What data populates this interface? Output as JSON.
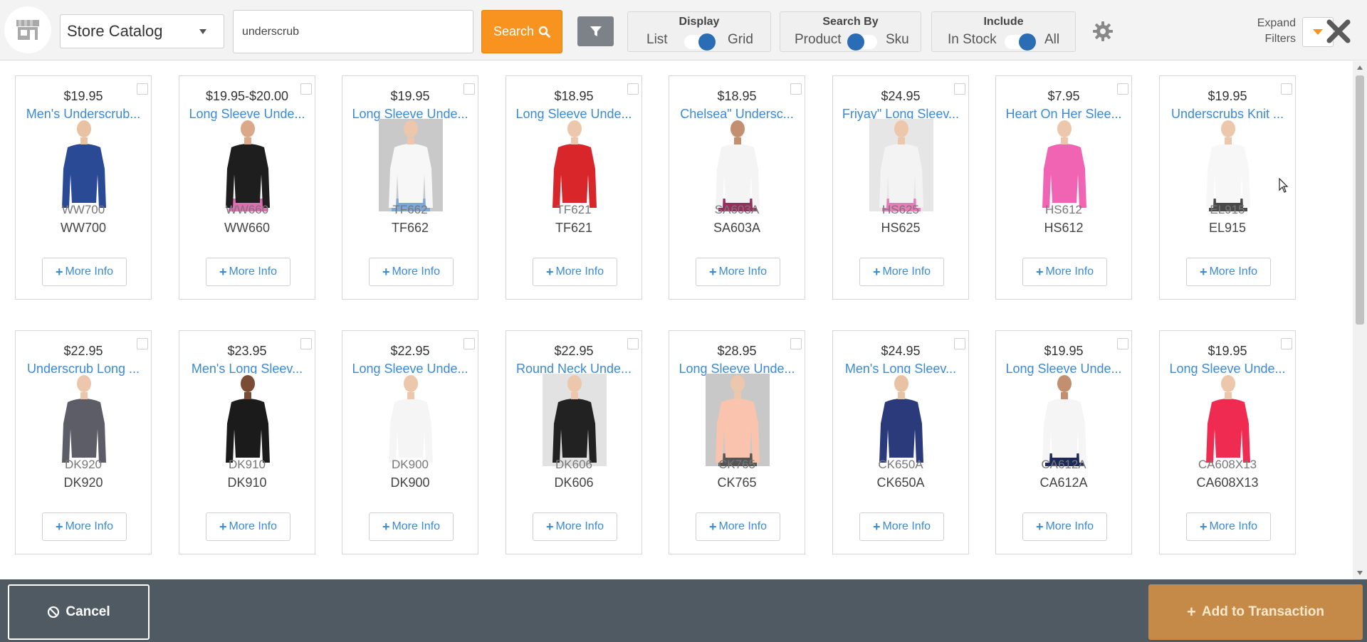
{
  "header": {
    "catalog_select": "Store Catalog",
    "search_value": "underscrub",
    "search_button": "Search",
    "display": {
      "title": "Display",
      "left": "List",
      "right": "Grid",
      "selected": "Grid"
    },
    "search_by": {
      "title": "Search By",
      "left": "Product",
      "right": "Sku",
      "selected": "Product"
    },
    "include": {
      "title": "Include",
      "left": "In Stock",
      "right": "All",
      "selected": "All"
    },
    "expand_filters_line1": "Expand",
    "expand_filters_line2": "Filters"
  },
  "colors": {
    "accent": "#f7931e",
    "link": "#3a8ad6",
    "toggle": "#2a6db5",
    "bottom_bar": "#505a63",
    "add_button": "#c58a48"
  },
  "products": [
    {
      "price": "$19.95",
      "name": "Men's Underscrub...",
      "sku": "WW700",
      "shirt": "#2b4a95",
      "pants": "",
      "bg": "#ffffff",
      "skin": "#e9c2a4"
    },
    {
      "price": "$19.95-$20.00",
      "name": "Long Sleeve Unde...",
      "sku": "WW660",
      "shirt": "#1e1e1e",
      "pants": "#e36bb2",
      "bg": "#ffffff",
      "skin": "#d9a98a"
    },
    {
      "price": "$19.95",
      "name": "Long Sleeve Unde...",
      "sku": "TF662",
      "shirt": "#f7f7f7",
      "pants": "#7ea8d8",
      "bg": "#c9c9c9",
      "skin": "#ecc7ab"
    },
    {
      "price": "$18.95",
      "name": "Long Sleeve Unde...",
      "sku": "TF621",
      "shirt": "#d8262b",
      "pants": "",
      "bg": "#ffffff",
      "skin": "#ecc7ab"
    },
    {
      "price": "$18.95",
      "name": "Chelsea\" Undersc...",
      "sku": "SA603A",
      "shirt": "#f4f4f4",
      "pants": "#9b2c5e",
      "bg": "#ffffff",
      "skin": "#c28f70"
    },
    {
      "price": "$24.95",
      "name": "Friyay\" Long Sleev...",
      "sku": "HS625",
      "shirt": "#f3f3f3",
      "pants": "#e97cb9",
      "bg": "#e6e6e6",
      "skin": "#ecc7ab"
    },
    {
      "price": "$7.95",
      "name": "Heart On Her Slee...",
      "sku": "HS612",
      "shirt": "#f064b3",
      "pants": "",
      "bg": "#ffffff",
      "skin": "#ecc7ab"
    },
    {
      "price": "$19.95",
      "name": "Underscrubs Knit ...",
      "sku": "EL915",
      "shirt": "#f7f7f7",
      "pants": "#4a4a4a",
      "bg": "#ffffff",
      "skin": "#ecc7ab"
    },
    {
      "price": "$22.95",
      "name": "Underscrub Long ...",
      "sku": "DK920",
      "shirt": "#5d5d68",
      "pants": "",
      "bg": "#ffffff",
      "skin": "#ecc7ab"
    },
    {
      "price": "$23.95",
      "name": "Men's Long Sleev...",
      "sku": "DK910",
      "shirt": "#1b1b1b",
      "pants": "",
      "bg": "#ffffff",
      "skin": "#7a4b35"
    },
    {
      "price": "$22.95",
      "name": "Long Sleeve Unde...",
      "sku": "DK900",
      "shirt": "#f5f5f5",
      "pants": "",
      "bg": "#ffffff",
      "skin": "#ecc7ab"
    },
    {
      "price": "$22.95",
      "name": "Round Neck Unde...",
      "sku": "DK606",
      "shirt": "#222222",
      "pants": "",
      "bg": "#e2e2e2",
      "skin": "#ecc7ab"
    },
    {
      "price": "$28.95",
      "name": "Long Sleeve Unde...",
      "sku": "CK765",
      "shirt": "#f9c3ad",
      "pants": "#555555",
      "bg": "#c8c8c8",
      "skin": "#ecc7ab"
    },
    {
      "price": "$24.95",
      "name": "Men's Long Sleev...",
      "sku": "CK650A",
      "shirt": "#2a3a7a",
      "pants": "",
      "bg": "#ffffff",
      "skin": "#e9c2a4"
    },
    {
      "price": "$19.95",
      "name": "Long Sleeve Unde...",
      "sku": "CA612A",
      "shirt": "#f5f5f5",
      "pants": "#1c2a5a",
      "bg": "#ffffff",
      "skin": "#c28f70"
    },
    {
      "price": "$19.95",
      "name": "Long Sleeve Unde...",
      "sku": "CA608X13",
      "shirt": "#ef2b52",
      "pants": "",
      "bg": "#ffffff",
      "skin": "#ecc7ab"
    }
  ],
  "more_info_label": "More Info",
  "footer": {
    "cancel": "Cancel",
    "add": "Add to Transaction"
  }
}
